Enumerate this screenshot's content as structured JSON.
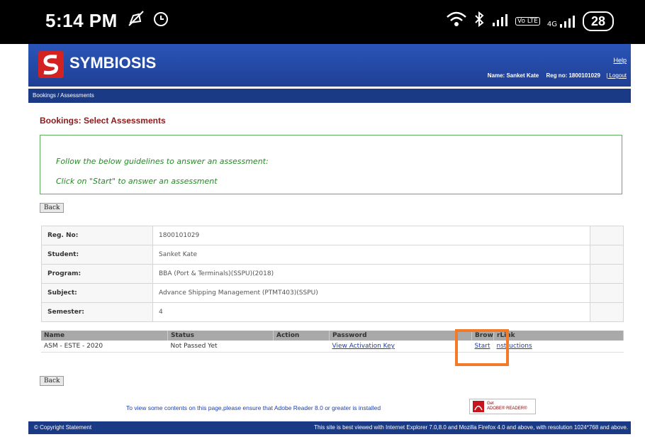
{
  "statusbar": {
    "time": "5:14 PM",
    "left_icons": [
      "mute-icon",
      "alarm-icon"
    ],
    "right_icons": [
      "wifi-icon",
      "bluetooth-icon",
      "signal-icon",
      "volte-icon",
      "4g-signal-icon"
    ],
    "volte": "Vo LTE",
    "net": "4G",
    "battery": "28"
  },
  "header": {
    "brand": "SYMBIOSIS",
    "help": "Help",
    "name_label": "Name:",
    "name_value": "Sanket Kate",
    "reg_label": "Reg no:",
    "reg_value": "1800101029",
    "logout": "| Logout",
    "brand_color": "#2147a6"
  },
  "nav": {
    "breadcrumb": "Bookings / Assessments"
  },
  "page": {
    "title": "Bookings: Select Assessments",
    "guide_line1": "Follow the below guidelines to answer an assessment:",
    "guide_line2": "Click on \"Start\" to answer an assessment",
    "back_label": "Back"
  },
  "info": {
    "rows": [
      {
        "label": "Reg. No:",
        "value": "1800101029"
      },
      {
        "label": "Student:",
        "value": "Sanket Kate"
      },
      {
        "label": "Program:",
        "value": "BBA (Port & Terminals)(SSPU)(2018)"
      },
      {
        "label": "Subject:",
        "value": "Advance Shipping Management (PTMT403)(SSPU)"
      },
      {
        "label": "Semester:",
        "value": "4"
      }
    ]
  },
  "assessments": {
    "headers": [
      "Name",
      "Status",
      "Action",
      "Password",
      "Brow",
      "rLink"
    ],
    "rows": [
      {
        "name": "ASM - ESTE - 2020",
        "status": "Not Passed Yet",
        "action": "",
        "password": "View Activation Key",
        "start": "Start",
        "instructions": "nstructions"
      }
    ]
  },
  "notice": {
    "text": "To view some contents on this page,please ensure that Adobe Reader 8.0 or greater is installed",
    "adobe_get": "Get",
    "adobe_reader": "ADOBE® READER®"
  },
  "footer": {
    "copyright": "© Copyright Statement",
    "browser_note": "This site is best viewed with Internet Explorer 7.0,8.0 and Mozilla Firefox 4.0 and above, with resolution 1024*768 and above."
  },
  "highlight_color": "#f27a2a"
}
